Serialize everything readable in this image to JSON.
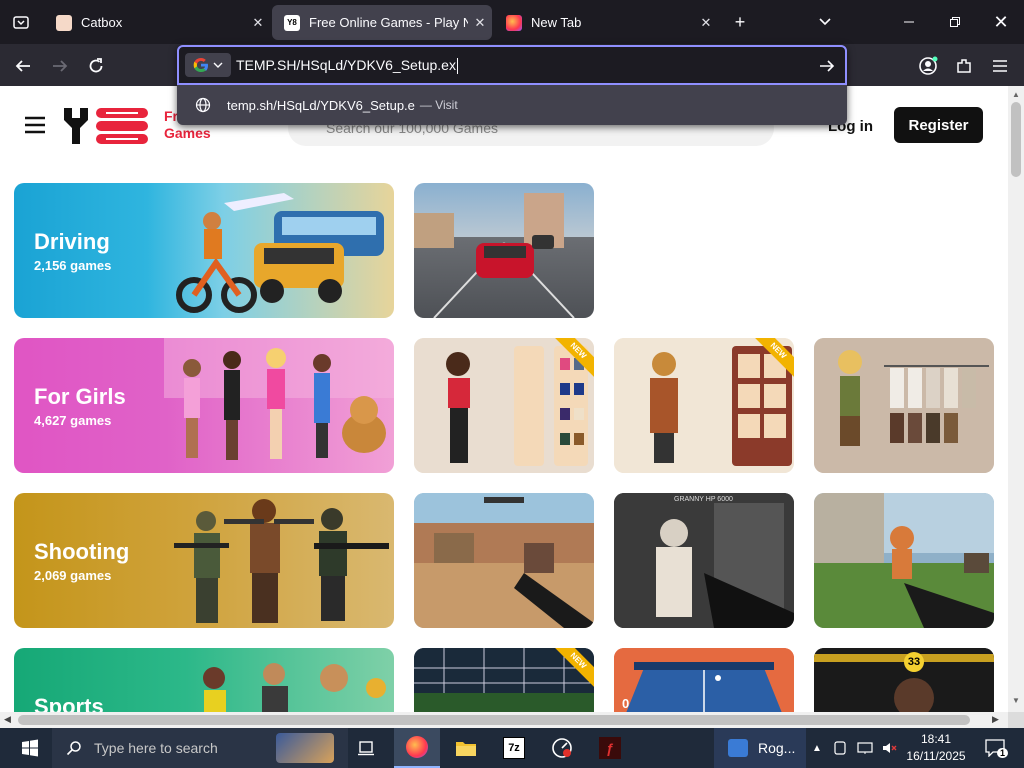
{
  "tabs": [
    {
      "title": "Catbox"
    },
    {
      "title": "Free Online Games - Play Now"
    },
    {
      "title": "New Tab"
    }
  ],
  "urlbar": {
    "value": "TEMP.SH/HSqLd/YDKV6_Setup.ex",
    "suggestion": "temp.sh/HSqLd/YDKV6_Setup.e",
    "suggestion_action": "— Visit"
  },
  "site": {
    "logo_text1": "Fr",
    "logo_text2": "Games",
    "search_placeholder": "Search our 100,000 Games",
    "login_label": "Log in",
    "register_label": "Register"
  },
  "categories": [
    {
      "name": "Driving",
      "count": "2,156 games"
    },
    {
      "name": "For Girls",
      "count": "4,627 games"
    },
    {
      "name": "Shooting",
      "count": "2,069 games"
    },
    {
      "name": "Sports"
    }
  ],
  "thumbs": {
    "new_label": "NEW",
    "granny_label": "GRANNY HP 6000",
    "zero": "0",
    "score33": "33"
  },
  "taskbar": {
    "search_placeholder": "Type here to search",
    "app_label": "Rog...",
    "time": "18:41",
    "date": "16/11/2025",
    "notif_count": "1"
  },
  "colors": {
    "accent": "#8f8fff",
    "brand_red": "#e8243c",
    "driving": "#27a9d6",
    "girls": "#e25bc6",
    "shooting": "#c79a1f",
    "sports": "#1fae79"
  }
}
